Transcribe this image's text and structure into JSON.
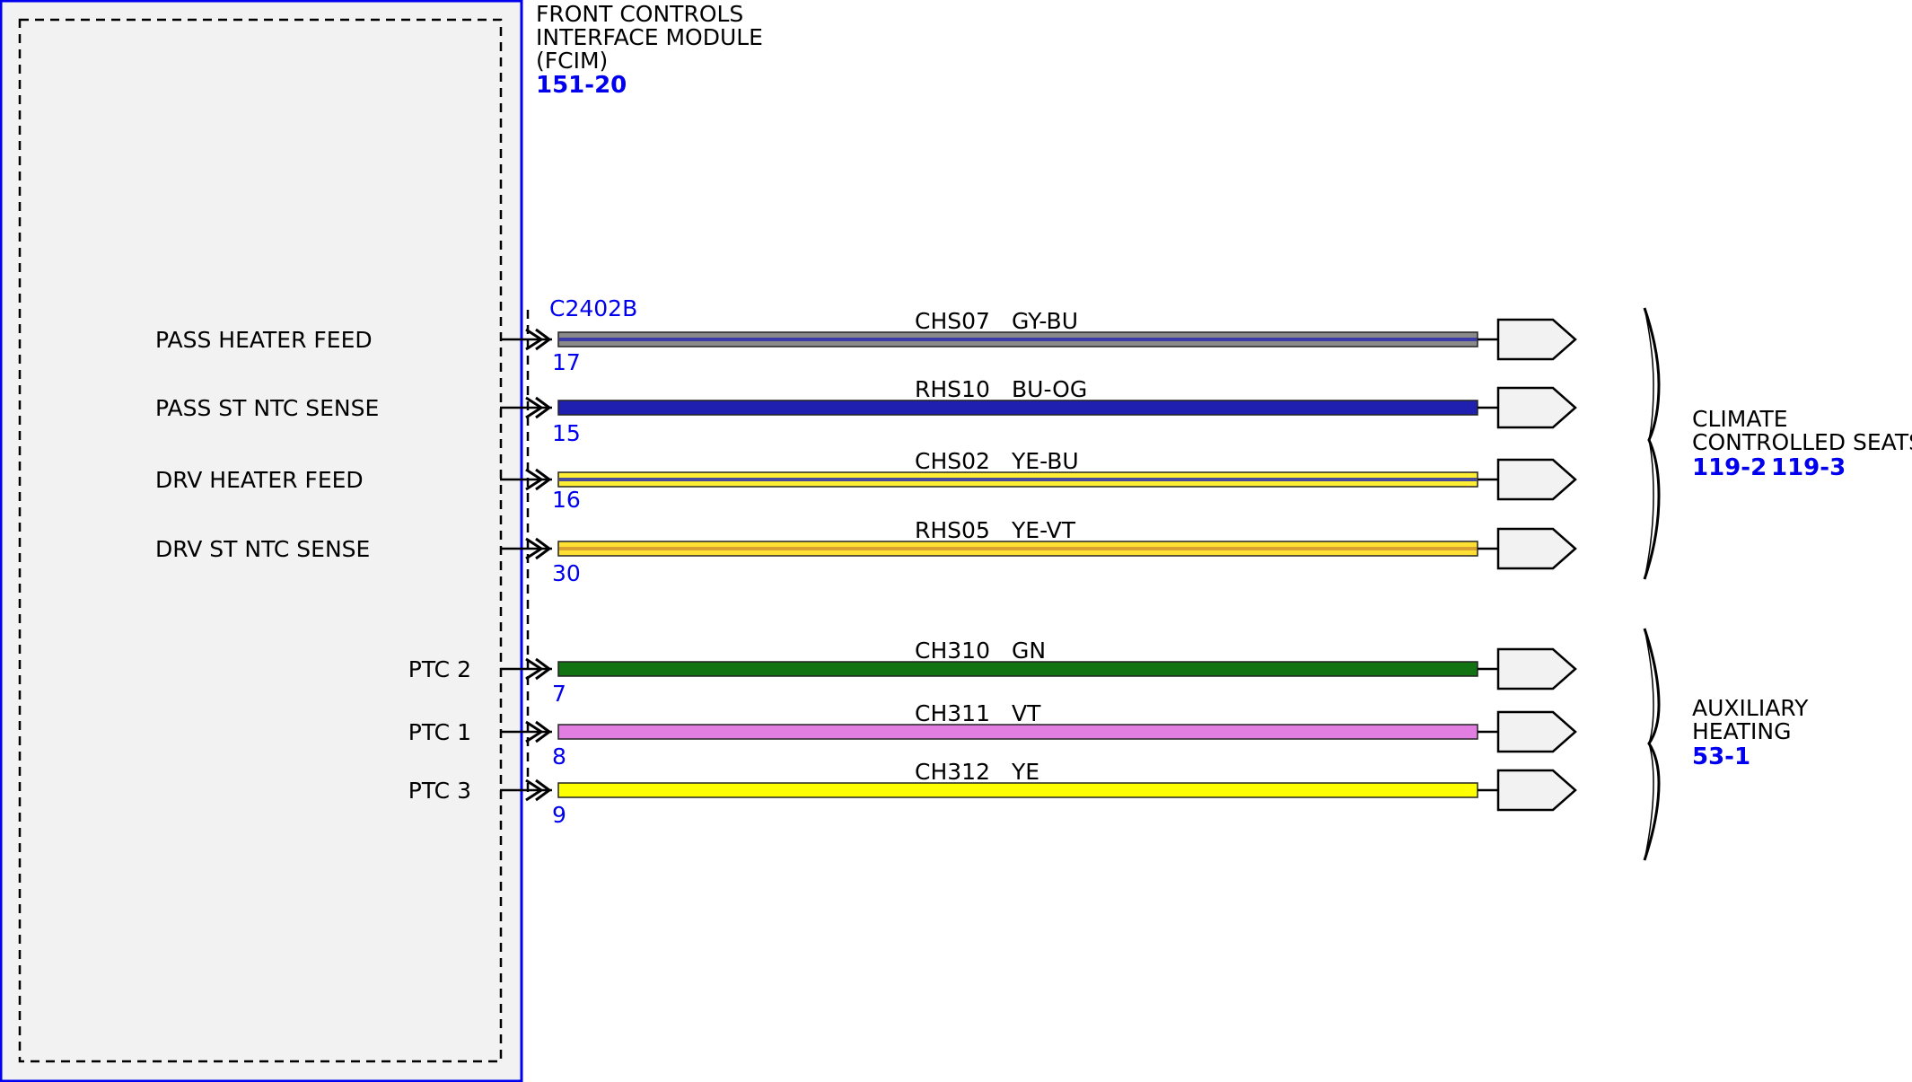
{
  "module": {
    "title_lines": [
      "FRONT CONTROLS",
      "INTERFACE MODULE",
      "(FCIM)"
    ],
    "ref": "151-20",
    "connector": "C2402B"
  },
  "colors": {
    "module_border": "#0000ee",
    "module_fill": "#f2f2f2",
    "ref_text": "#0000ee"
  },
  "wires": [
    {
      "signal": "PASS HEATER FEED",
      "pin": "17",
      "circuit": "CHS07",
      "color_code": "GY-BU",
      "primary": "#8a8a8a",
      "stripe": "#3a3aa8"
    },
    {
      "signal": "PASS ST NTC SENSE",
      "pin": "15",
      "circuit": "RHS10",
      "color_code": "BU-OG",
      "primary": "#1f1fb0",
      "stripe": "#1f1fb0"
    },
    {
      "signal": "DRV HEATER FEED",
      "pin": "16",
      "circuit": "CHS02",
      "color_code": "YE-BU",
      "primary": "#ffee33",
      "stripe": "#4a4a9a"
    },
    {
      "signal": "DRV ST NTC SENSE",
      "pin": "30",
      "circuit": "RHS05",
      "color_code": "YE-VT",
      "primary": "#ffe033",
      "stripe": "#d8a030"
    },
    {
      "signal": "PTC 2",
      "pin": "7",
      "circuit": "CH310",
      "color_code": "GN",
      "primary": "#127312",
      "stripe": "#127312"
    },
    {
      "signal": "PTC 1",
      "pin": "8",
      "circuit": "CH311",
      "color_code": "VT",
      "primary": "#e27ee2",
      "stripe": "#e27ee2"
    },
    {
      "signal": "PTC 3",
      "pin": "9",
      "circuit": "CH312",
      "color_code": "YE",
      "primary": "#ffff00",
      "stripe": "#ffff00"
    }
  ],
  "destinations": [
    {
      "title_lines": [
        "CLIMATE",
        "CONTROLLED SEATS"
      ],
      "refs": [
        "119-2",
        "119-3"
      ]
    },
    {
      "title_lines": [
        "AUXILIARY",
        "HEATING"
      ],
      "refs": [
        "53-1"
      ]
    }
  ]
}
